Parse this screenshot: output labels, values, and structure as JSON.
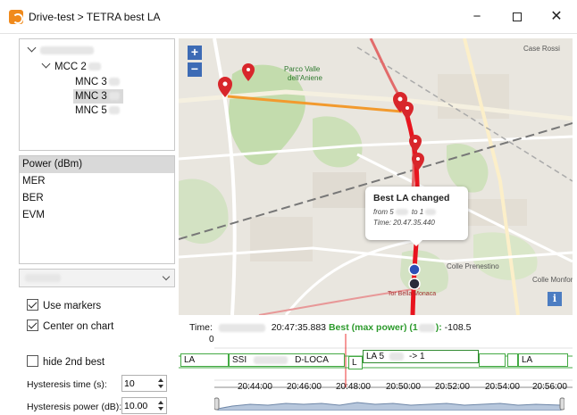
{
  "window": {
    "title": "Drive-test > TETRA best LA",
    "min_glyph": "−",
    "close_glyph": "✕"
  },
  "tree": {
    "root_label": "",
    "mcc_label": "MCC 2",
    "mnc_items": [
      "MNC 3",
      "MNC 3",
      "MNC 5"
    ]
  },
  "metrics": [
    "Power (dBm)",
    "MER",
    "BER",
    "EVM"
  ],
  "dropdown": {
    "value": ""
  },
  "options": {
    "use_markers": "Use markers",
    "center_on_chart": "Center on chart",
    "hide_2nd_best": "hide 2nd best",
    "hysteresis_time_label": "Hysteresis time (s):",
    "hysteresis_time_value": "10",
    "hysteresis_power_label": "Hysteresis power (dB):",
    "hysteresis_power_value": "10.00"
  },
  "map": {
    "zoom_in": "+",
    "zoom_out": "−",
    "info": "i",
    "labels": {
      "parco": "Parco Valle",
      "aniene": "dell'Aniene",
      "case_rossi": "Case Rossi",
      "prenestino": "Colle Prenestino",
      "monforte": "Colle Monforte",
      "tor_bella": "Tor Bella Monaca"
    },
    "popup": {
      "title": "Best LA changed",
      "from_prefix": "from 5",
      "to_prefix": "to 1",
      "time": "Time: 20.47.35.440"
    },
    "colors": {
      "route_red": "#e8141e",
      "handover_orange": "#f29a2e",
      "marker_blue": "#2b4fb5"
    }
  },
  "timeline": {
    "time_prefix": "Time:",
    "time_value": "20:47:35.883",
    "best_label": "Best (max power) (1",
    "best_suffix": "):",
    "best_value": "-108.5",
    "zero": "0",
    "boxes": {
      "la1": "LA",
      "ssi": "SSI",
      "dloca": "D-LOCA",
      "l": "L",
      "la5": "LA 5",
      "arrow": "-> 1",
      "la2": "LA"
    },
    "ticks": [
      "20:44:00",
      "20:46:00",
      "20:48:00",
      "20:50:00",
      "20:52:00",
      "20:54:00",
      "20:56:00"
    ]
  }
}
